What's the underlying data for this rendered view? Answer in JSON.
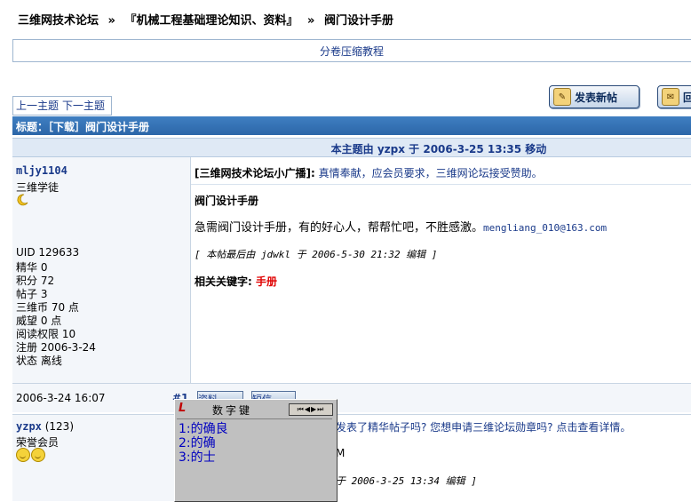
{
  "breadcrumb": {
    "items": [
      "三维网技术论坛",
      "»",
      "『机械工程基础理论知识、资料』",
      "»",
      "阀门设计手册"
    ]
  },
  "ad": {
    "text": "分卷压缩教程"
  },
  "topic_nav": {
    "prev": "上一主题",
    "next": "下一主题"
  },
  "buttons": {
    "new_post": "发表新帖",
    "reply": "回复"
  },
  "thread": {
    "title": "标题：［下载］阀门设计手册",
    "moved_notice": "本主题由 yzpx 于 2006-3-25 13:35 移动"
  },
  "post1": {
    "author": "mljy1104",
    "rank": "三维学徒",
    "stats": [
      "UID 129633",
      "精华 0",
      "积分 72",
      "帖子 3",
      "三维币 70 点",
      "威望 0 点",
      "阅读权限 10",
      "注册 2006-3-24",
      "状态 离线"
    ],
    "time": "2006-3-24 16:07",
    "floor": "#1",
    "broadcast_label": "[三维网技术论坛小广播]:",
    "broadcast_text": "真情奉献，应会员要求，三维网论坛接受赞助。",
    "subject": "阀门设计手册",
    "body": "急需阀门设计手册，有的好心人，帮帮忙吧，不胜感激。",
    "email": "mengliang_010@163.com",
    "edit_note": "[ 本帖最后由 jdwkl 于 2006-5-30 21:32 编辑 ]",
    "keywords_label": "相关关键字:",
    "keyword": "手册",
    "action_buttons": [
      "资料",
      "短信"
    ]
  },
  "post2": {
    "author": "yzpx",
    "count": "(123)",
    "rank": "荣誉会员",
    "broadcast_text": "发表了精华帖子吗? 您想申请三维论坛勋章吗? 点击查看详情。",
    "partial_text": "M",
    "edit_note": "于 2006-3-25 13:34 编辑 ]"
  },
  "ime": {
    "logo": "L",
    "title": "数字键",
    "candidates": [
      "1:的确良",
      "2:的确",
      "3:的士"
    ]
  },
  "colors": {
    "accent": "#2c66a8",
    "keyword": "#e00000",
    "link": "#1a3a8a"
  }
}
